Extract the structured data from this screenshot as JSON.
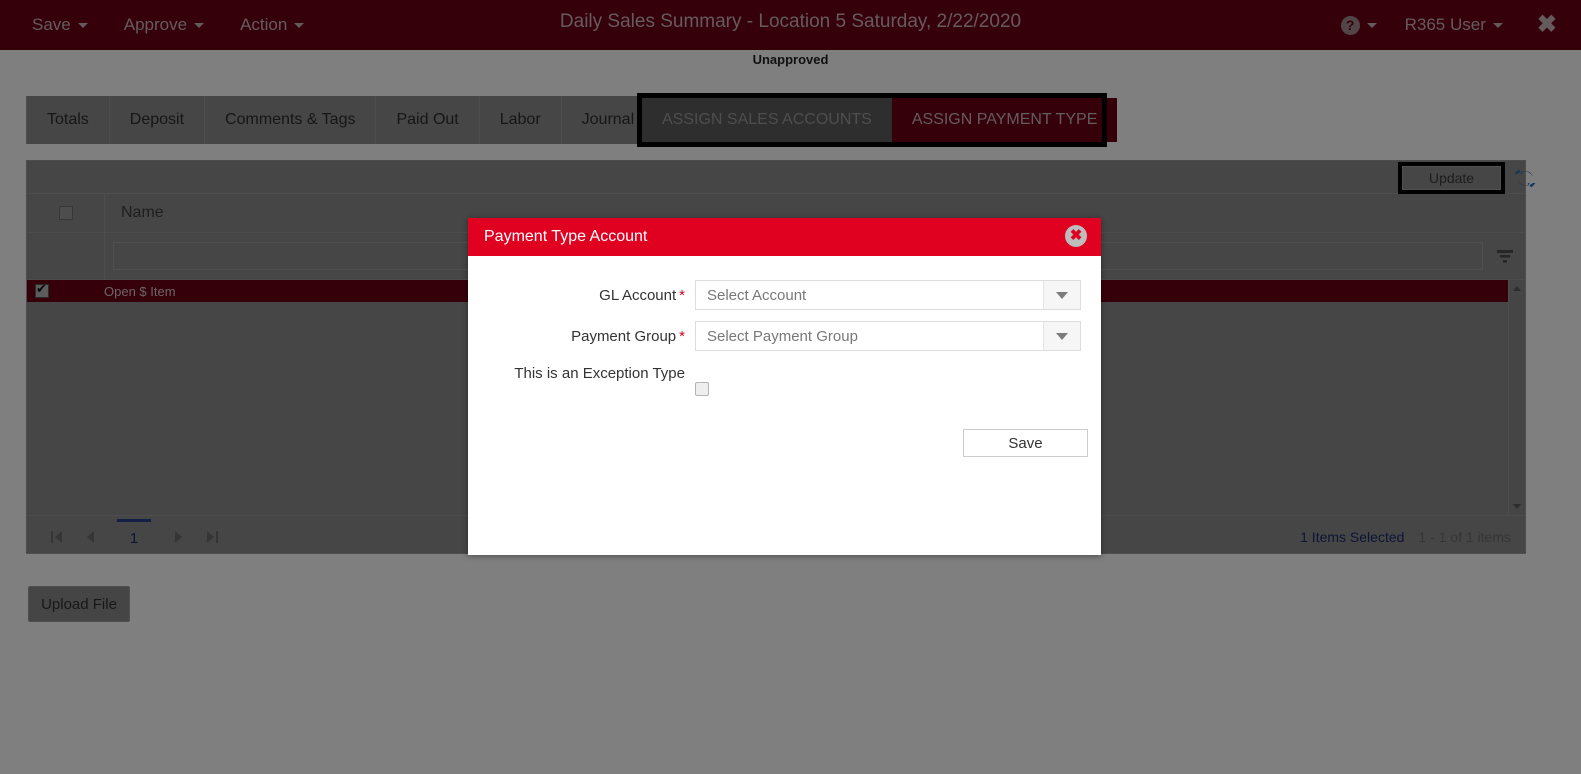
{
  "header": {
    "menu": [
      {
        "label": "Save",
        "icon": "chevron-down-icon"
      },
      {
        "label": "Approve",
        "icon": "chevron-down-icon"
      },
      {
        "label": "Action",
        "icon": "chevron-down-icon"
      }
    ],
    "title": "Daily Sales Summary - Location 5 Saturday, 2/22/2020",
    "help_icon": "question-mark-icon",
    "user_label": "R365 User",
    "close_icon": "close-x-icon",
    "bar_color": "#6d0016"
  },
  "status": {
    "label": "Unapproved"
  },
  "tabs": {
    "items": [
      {
        "label": "Totals"
      },
      {
        "label": "Deposit"
      },
      {
        "label": "Comments & Tags"
      },
      {
        "label": "Paid Out"
      },
      {
        "label": "Labor"
      },
      {
        "label": "Journal Entry"
      }
    ],
    "highlighted": [
      {
        "label": "ASSIGN SALES ACCOUNTS",
        "state": "inactive"
      },
      {
        "label": "ASSIGN PAYMENT TYPE",
        "state": "active"
      }
    ]
  },
  "grid": {
    "update_button": "Update",
    "refresh_icon": "refresh-icon",
    "filter_icon": "filter-funnel-icon",
    "filter_value": "",
    "filter_placeholder": "",
    "columns": [
      "Name"
    ],
    "select_all_checked": false,
    "rows": [
      {
        "name": "Open $ Item",
        "checked": true,
        "selected": true
      }
    ],
    "pager": {
      "first_icon": "first-page-icon",
      "prev_icon": "previous-page-icon",
      "next_icon": "next-page-icon",
      "last_icon": "last-page-icon",
      "current_page": "1",
      "items_selected": "1 Items Selected",
      "items_range": "1 - 1 of 1 items"
    }
  },
  "footer": {
    "upload_button": "Upload File"
  },
  "modal": {
    "title": "Payment Type Account",
    "close_icon": "close-circle-icon",
    "title_color": "#e00020",
    "fields": [
      {
        "label": "GL Account",
        "required": "*",
        "value": "Select Account",
        "icon": "chevron-down-icon"
      },
      {
        "label": "Payment Group",
        "required": "*",
        "value": "Select Payment Group",
        "icon": "chevron-down-icon"
      }
    ],
    "exception": {
      "label": "This is an Exception Type",
      "checked": false
    },
    "save_button": "Save"
  }
}
